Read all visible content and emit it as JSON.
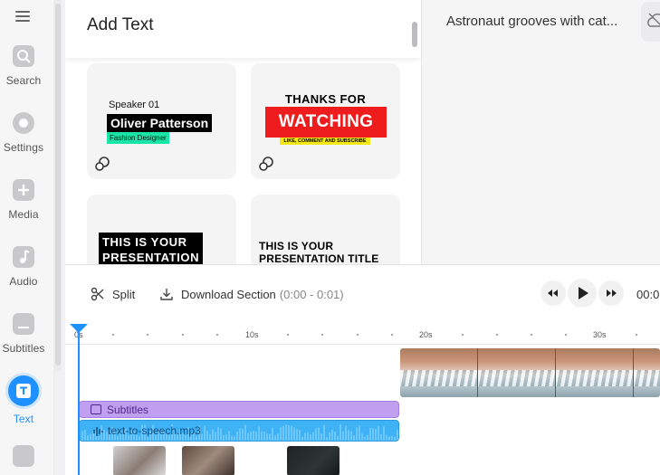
{
  "rail": {
    "items": [
      {
        "label": "Search",
        "icon": "search-icon"
      },
      {
        "label": "Settings",
        "icon": "gear-icon"
      },
      {
        "label": "Media",
        "icon": "plus-icon"
      },
      {
        "label": "Audio",
        "icon": "music-note-icon"
      },
      {
        "label": "Subtitles",
        "icon": "subtitles-icon"
      },
      {
        "label": "Text",
        "icon": "text-icon",
        "active": true
      }
    ]
  },
  "panel": {
    "title": "Add Text",
    "cards": [
      {
        "speaker": "Speaker 01",
        "name": "Oliver Patterson",
        "role": "Fashion Designer"
      },
      {
        "line1": "THANKS FOR",
        "line2": "WATCHING",
        "line3": "LIKE, COMMENT AND SUBSCRIBE"
      },
      {
        "line1": "THIS IS YOUR",
        "line2": "PRESENTATION"
      },
      {
        "line1": "THIS IS YOUR",
        "line2": "PRESENTATION TITLE"
      }
    ]
  },
  "preview": {
    "title": "Astronaut grooves with cat..."
  },
  "toolbar": {
    "split_label": "Split",
    "download_label": "Download Section",
    "download_range": "(0:00 - 0:01)",
    "time": "00:0"
  },
  "ruler": {
    "labels": [
      "0s",
      "10s",
      "20s",
      "30s"
    ]
  },
  "tracks": {
    "subtitles_label": "Subtitles",
    "audio_label": "text-to-speech.mp3"
  },
  "colors": {
    "accent": "#1e90ff",
    "subtitles_track": "#c19ff0",
    "audio_track": "#3fb1f5"
  }
}
